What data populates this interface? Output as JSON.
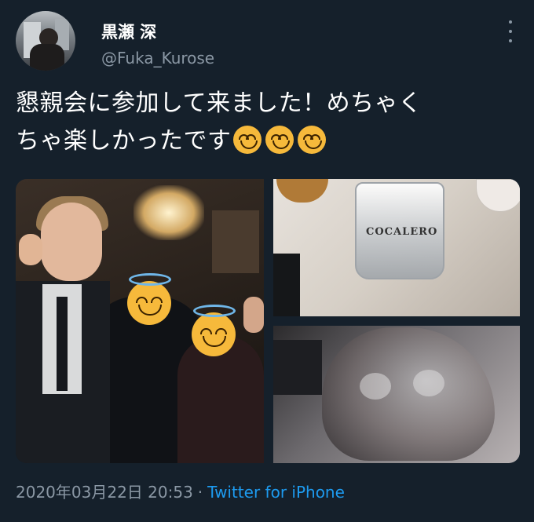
{
  "author": {
    "display_name": "黒瀬 深",
    "handle": "@Fuka_Kurose"
  },
  "tweet": {
    "text_line1": "懇親会に参加して来ました！めちゃく",
    "text_line2": "ちゃ楽しかったです",
    "emojis": [
      "smiling-face-emoji",
      "smiling-face-emoji",
      "smiling-face-emoji"
    ]
  },
  "media": {
    "photo_2_label": "COCALERO"
  },
  "meta": {
    "timestamp": "2020年03月22日 20:53",
    "separator": "·",
    "source": "Twitter for iPhone"
  },
  "colors": {
    "background": "#15202b",
    "text": "#ffffff",
    "secondary": "#8b98a5",
    "link": "#1d9bf0"
  }
}
